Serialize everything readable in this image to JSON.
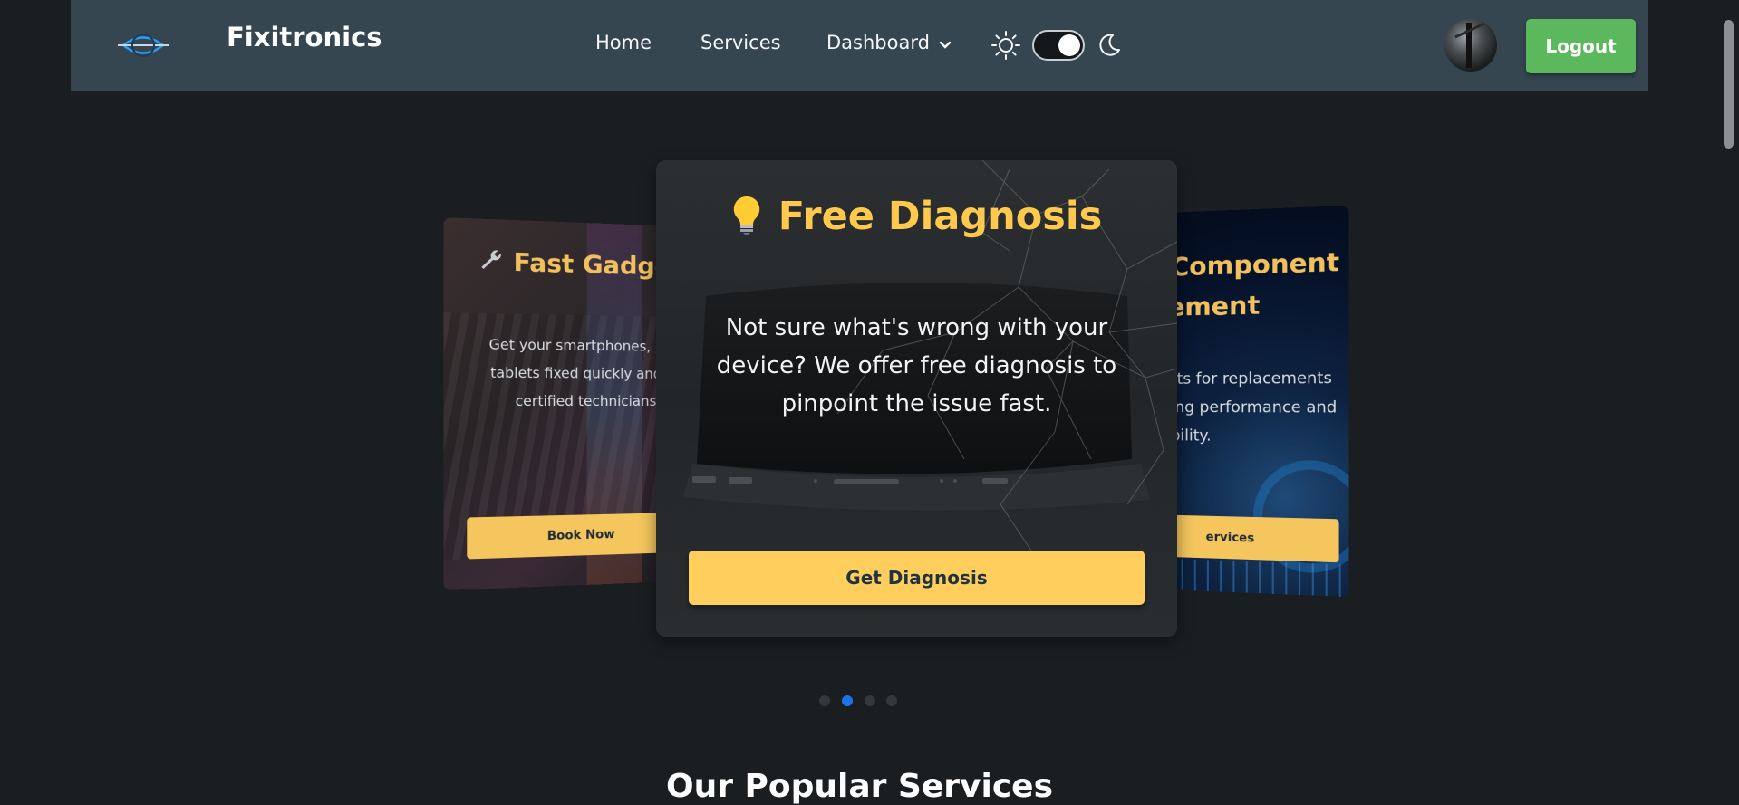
{
  "navbar": {
    "brand": "Fixitronics",
    "links": [
      {
        "label": "Home"
      },
      {
        "label": "Services"
      },
      {
        "label": "Dashboard"
      }
    ],
    "logout_label": "Logout",
    "theme_toggle_on": true
  },
  "carousel": {
    "left_card": {
      "title": "Fast Gadget R",
      "text": "Get your smartphones, lapt tablets fixed quickly and re certified technicians",
      "button": "Book Now"
    },
    "center_card": {
      "title": "Free Diagnosis",
      "text": "Not sure what's wrong with your device? We offer free diagnosis to pinpoint the issue fast.",
      "button": "Get Diagnosis"
    },
    "right_card": {
      "title_line1": "Component",
      "title_line2": "cement",
      "text_line1": "rts for replacements",
      "text_line2": "ing performance and",
      "text_line3": "bility.",
      "button": "ervices"
    },
    "dots": 4,
    "active_dot": 2
  },
  "section": {
    "title": "Our Popular Services"
  },
  "colors": {
    "accent": "#ffce5c",
    "logout": "#5cb85c",
    "navbar": "#354650",
    "background": "#1b1e21",
    "active_dot": "#1a73e8"
  },
  "icons": [
    "logo-icon",
    "sun-icon",
    "moon-icon",
    "chevron-down-icon",
    "lightbulb-icon",
    "wrench-icon"
  ]
}
